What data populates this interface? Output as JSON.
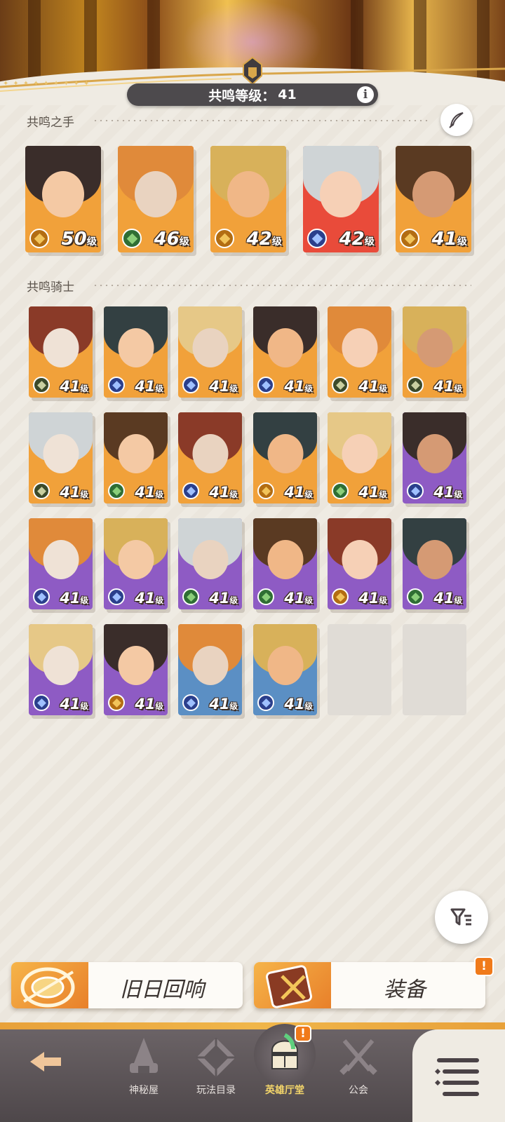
{
  "header": {
    "resonance_label": "共鸣等级：",
    "resonance_level": "41",
    "info_label": "i"
  },
  "sections": {
    "hands_title": "共鸣之手",
    "knights_title": "共鸣骑士"
  },
  "level_unit": "级",
  "hands": [
    {
      "level": "50",
      "faction": "light-bearer",
      "bg": "#f1a13a"
    },
    {
      "level": "46",
      "faction": "wilder",
      "bg": "#f1a13a"
    },
    {
      "level": "42",
      "faction": "light-bearer",
      "bg": "#f1a13a"
    },
    {
      "level": "42",
      "faction": "celestial",
      "bg": "#e94b3a"
    },
    {
      "level": "41",
      "faction": "light-bearer",
      "bg": "#f1a13a"
    }
  ],
  "knights": [
    {
      "level": "41",
      "faction": "graveborn",
      "bg": "#f1a13a"
    },
    {
      "level": "41",
      "faction": "celestial",
      "bg": "#f1a13a"
    },
    {
      "level": "41",
      "faction": "celestial",
      "bg": "#f1a13a"
    },
    {
      "level": "41",
      "faction": "celestial",
      "bg": "#f1a13a"
    },
    {
      "level": "41",
      "faction": "graveborn",
      "bg": "#f1a13a"
    },
    {
      "level": "41",
      "faction": "graveborn",
      "bg": "#f1a13a"
    },
    {
      "level": "41",
      "faction": "graveborn",
      "bg": "#f1a13a"
    },
    {
      "level": "41",
      "faction": "wilder",
      "bg": "#f1a13a"
    },
    {
      "level": "41",
      "faction": "celestial",
      "bg": "#f1a13a"
    },
    {
      "level": "41",
      "faction": "light-bearer",
      "bg": "#f1a13a"
    },
    {
      "level": "41",
      "faction": "wilder",
      "bg": "#f1a13a"
    },
    {
      "level": "41",
      "faction": "celestial",
      "bg": "#8e5bc4"
    },
    {
      "level": "41",
      "faction": "celestial",
      "bg": "#8e5bc4"
    },
    {
      "level": "41",
      "faction": "celestial",
      "bg": "#8e5bc4"
    },
    {
      "level": "41",
      "faction": "wilder",
      "bg": "#8e5bc4"
    },
    {
      "level": "41",
      "faction": "wilder",
      "bg": "#8e5bc4"
    },
    {
      "level": "41",
      "faction": "light-bearer",
      "bg": "#8e5bc4"
    },
    {
      "level": "41",
      "faction": "wilder",
      "bg": "#8e5bc4"
    },
    {
      "level": "41",
      "faction": "celestial",
      "bg": "#8e5bc4"
    },
    {
      "level": "41",
      "faction": "light-bearer",
      "bg": "#8e5bc4"
    },
    {
      "level": "41",
      "faction": "celestial",
      "bg": "#5b8fc4"
    },
    {
      "level": "41",
      "faction": "celestial",
      "bg": "#5b8fc4"
    }
  ],
  "buttons": {
    "echoes_label": "旧日回响",
    "equipment_label": "装备",
    "equipment_alert": "!"
  },
  "nav": {
    "back_label": "",
    "items": [
      {
        "label": "神秘屋"
      },
      {
        "label": "玩法目录"
      },
      {
        "label": "英雄厅堂"
      },
      {
        "label": "公会"
      }
    ],
    "hall_alert": "!"
  },
  "colors": {
    "accent_gold": "#f0b64a",
    "level_bar": "#4d4a4d",
    "alert": "#f07a1a",
    "orange_card": "#f1a13a",
    "purple_card": "#8e5bc4",
    "blue_card": "#5b8fc4"
  }
}
